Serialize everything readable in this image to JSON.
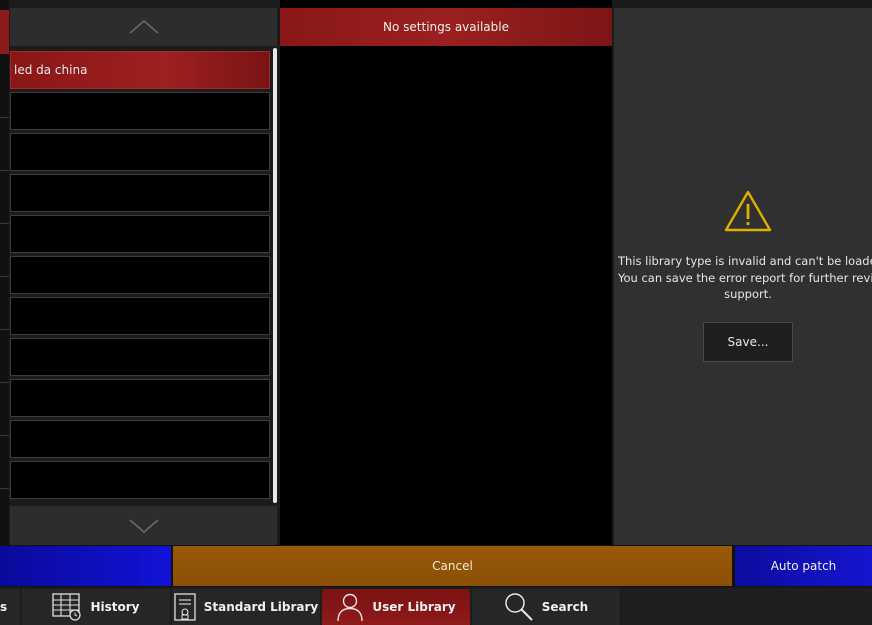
{
  "list": {
    "items": [
      "led da china",
      "",
      "",
      "",
      "",
      "",
      "",
      "",
      "",
      "",
      ""
    ],
    "selected_index": 0
  },
  "settings": {
    "header": "No settings available"
  },
  "error_panel": {
    "line1": "This library type is invalid and can't be loaded.",
    "line2": "You can save the error report for further review",
    "line3": "support.",
    "save_label": "Save..."
  },
  "actions": {
    "cancel_label": "Cancel",
    "auto_patch_label": "Auto patch"
  },
  "tabs": {
    "partial_label": "s",
    "history": "History",
    "standard_library": "Standard Library",
    "user_library": "User Library",
    "search": "Search",
    "active": "User Library"
  },
  "colors": {
    "accent_red": "#8e1a1a",
    "cancel_orange": "#9a5a06",
    "action_blue": "#1212d8",
    "warning_yellow": "#e0b000"
  }
}
